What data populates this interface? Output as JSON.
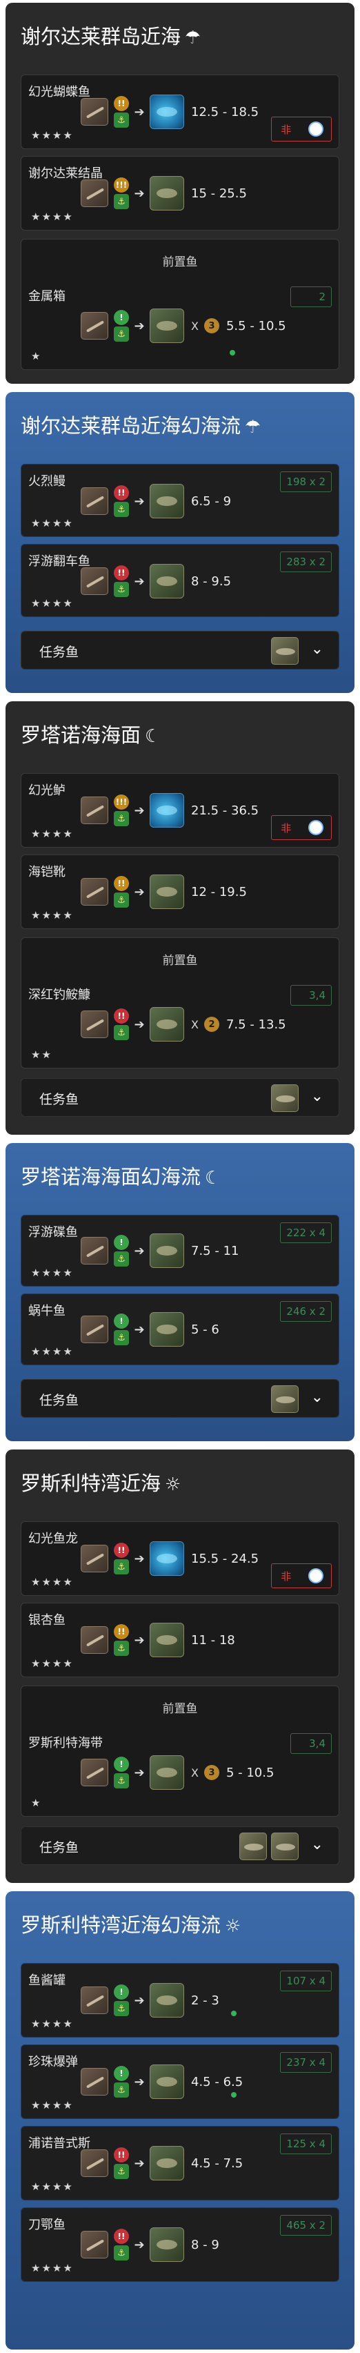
{
  "sections": [
    {
      "title": "谢尔达莱群岛近海",
      "weather_icon": "rain-icon",
      "fish": [
        {
          "name": "幻光蝴蝶鱼",
          "stars": "★★★★",
          "tugs": [
            "!!"
          ],
          "hook": "hook-icon",
          "range": "12.5 - 18.5",
          "weather_label": "非"
        },
        {
          "name": "谢尔达莱结晶",
          "stars": "★★★★",
          "tugs": [
            "!!!"
          ],
          "hook": "hook-icon",
          "range": "15 - 25.5"
        },
        {
          "name": "金属箱",
          "stars": "★",
          "tugs": [
            "!"
          ],
          "hook": "hook-icon",
          "times": "X",
          "coin": "3",
          "range": "5.5 - 10.5",
          "count": "2"
        }
      ],
      "prereq_label": "前置鱼"
    },
    {
      "title": "谢尔达莱群岛近海幻海流",
      "weather_icon": "rain-icon",
      "fish": [
        {
          "name": "火烈鳗",
          "stars": "★★★★",
          "tugs": [
            "!!"
          ],
          "hook": "hook-icon",
          "range": "6.5 - 9",
          "count": "198 x 2"
        },
        {
          "name": "浮游翻车鱼",
          "stars": "★★★★",
          "tugs": [
            "!!"
          ],
          "hook": "hook-icon",
          "range": "8 - 9.5",
          "count": "283 x 2"
        }
      ],
      "task_label": "任务鱼"
    },
    {
      "title": "罗塔诺海海面",
      "weather_icon": "moon-icon",
      "fish": [
        {
          "name": "幻光鲈",
          "stars": "★★★★",
          "tugs": [
            "!!!"
          ],
          "hook": "hook-icon",
          "range": "21.5 - 36.5",
          "weather_label": "非"
        },
        {
          "name": "海铠靴",
          "stars": "★★★★",
          "tugs": [
            "!!"
          ],
          "hook": "hook-icon",
          "range": "12 - 19.5"
        },
        {
          "name": "深红钓鮟鱇",
          "stars": "★★",
          "tugs": [
            "!!"
          ],
          "hook": "hook-icon",
          "times": "X",
          "coin": "2",
          "range": "7.5 - 13.5",
          "count": "3,4"
        }
      ],
      "prereq_label": "前置鱼",
      "task_label": "任务鱼"
    },
    {
      "title": "罗塔诺海海面幻海流",
      "weather_icon": "moon-icon",
      "fish": [
        {
          "name": "浮游碟鱼",
          "stars": "★★★★",
          "tugs": [
            "!"
          ],
          "hook": "hook-icon",
          "range": "7.5 - 11",
          "count": "222 x 4"
        },
        {
          "name": "蜗牛鱼",
          "stars": "★★★★",
          "tugs": [
            "!"
          ],
          "hook": "hook-icon",
          "range": "5 - 6",
          "count": "246 x 2"
        }
      ],
      "task_label": "任务鱼"
    },
    {
      "title": "罗斯利特湾近海",
      "weather_icon": "sun-icon",
      "fish": [
        {
          "name": "幻光鱼龙",
          "stars": "★★★★",
          "tugs": [
            "!!"
          ],
          "hook": "hook-icon",
          "range": "15.5 - 24.5",
          "weather_label": "非"
        },
        {
          "name": "银杏鱼",
          "stars": "★★★★",
          "tugs": [
            "!!"
          ],
          "hook": "hook-icon",
          "range": "11 - 18"
        },
        {
          "name": "罗斯利特海带",
          "stars": "★",
          "tugs": [
            "!"
          ],
          "hook": "hook-icon",
          "times": "X",
          "coin": "3",
          "range": "5 - 10.5",
          "count": "3,4"
        }
      ],
      "prereq_label": "前置鱼",
      "task_label": "任务鱼"
    },
    {
      "title": "罗斯利特湾近海幻海流",
      "weather_icon": "sun-icon",
      "fish": [
        {
          "name": "鱼酱罐",
          "stars": "★★★★",
          "tugs": [
            "!"
          ],
          "hook": "hook-icon",
          "range": "2 - 3",
          "count": "107 x 4"
        },
        {
          "name": "珍珠爆弹",
          "stars": "★★★★",
          "tugs": [
            "!"
          ],
          "hook": "hook-icon",
          "range": "4.5 - 6.5",
          "count": "237 x 4"
        },
        {
          "name": "浦诺普式斯",
          "stars": "★★★★",
          "tugs": [
            "!!"
          ],
          "hook": "hook-icon",
          "range": "4.5 - 7.5",
          "count": "125 x 4"
        },
        {
          "name": "刀鄂鱼",
          "stars": "★★★★",
          "tugs": [
            "!!"
          ],
          "hook": "hook-icon",
          "range": "8 - 9",
          "count": "465 x 2"
        }
      ]
    }
  ],
  "colors": {
    "dark_bg": "#2a2a2a",
    "blue_bg": "#3363a1",
    "card_bg": "#1a1a1a",
    "count_green": "#3d8c5a",
    "weather_red": "#c23a3a",
    "tug_amber": "#c68a18",
    "tug_red": "#c8323a",
    "tug_green": "#39a44a"
  }
}
